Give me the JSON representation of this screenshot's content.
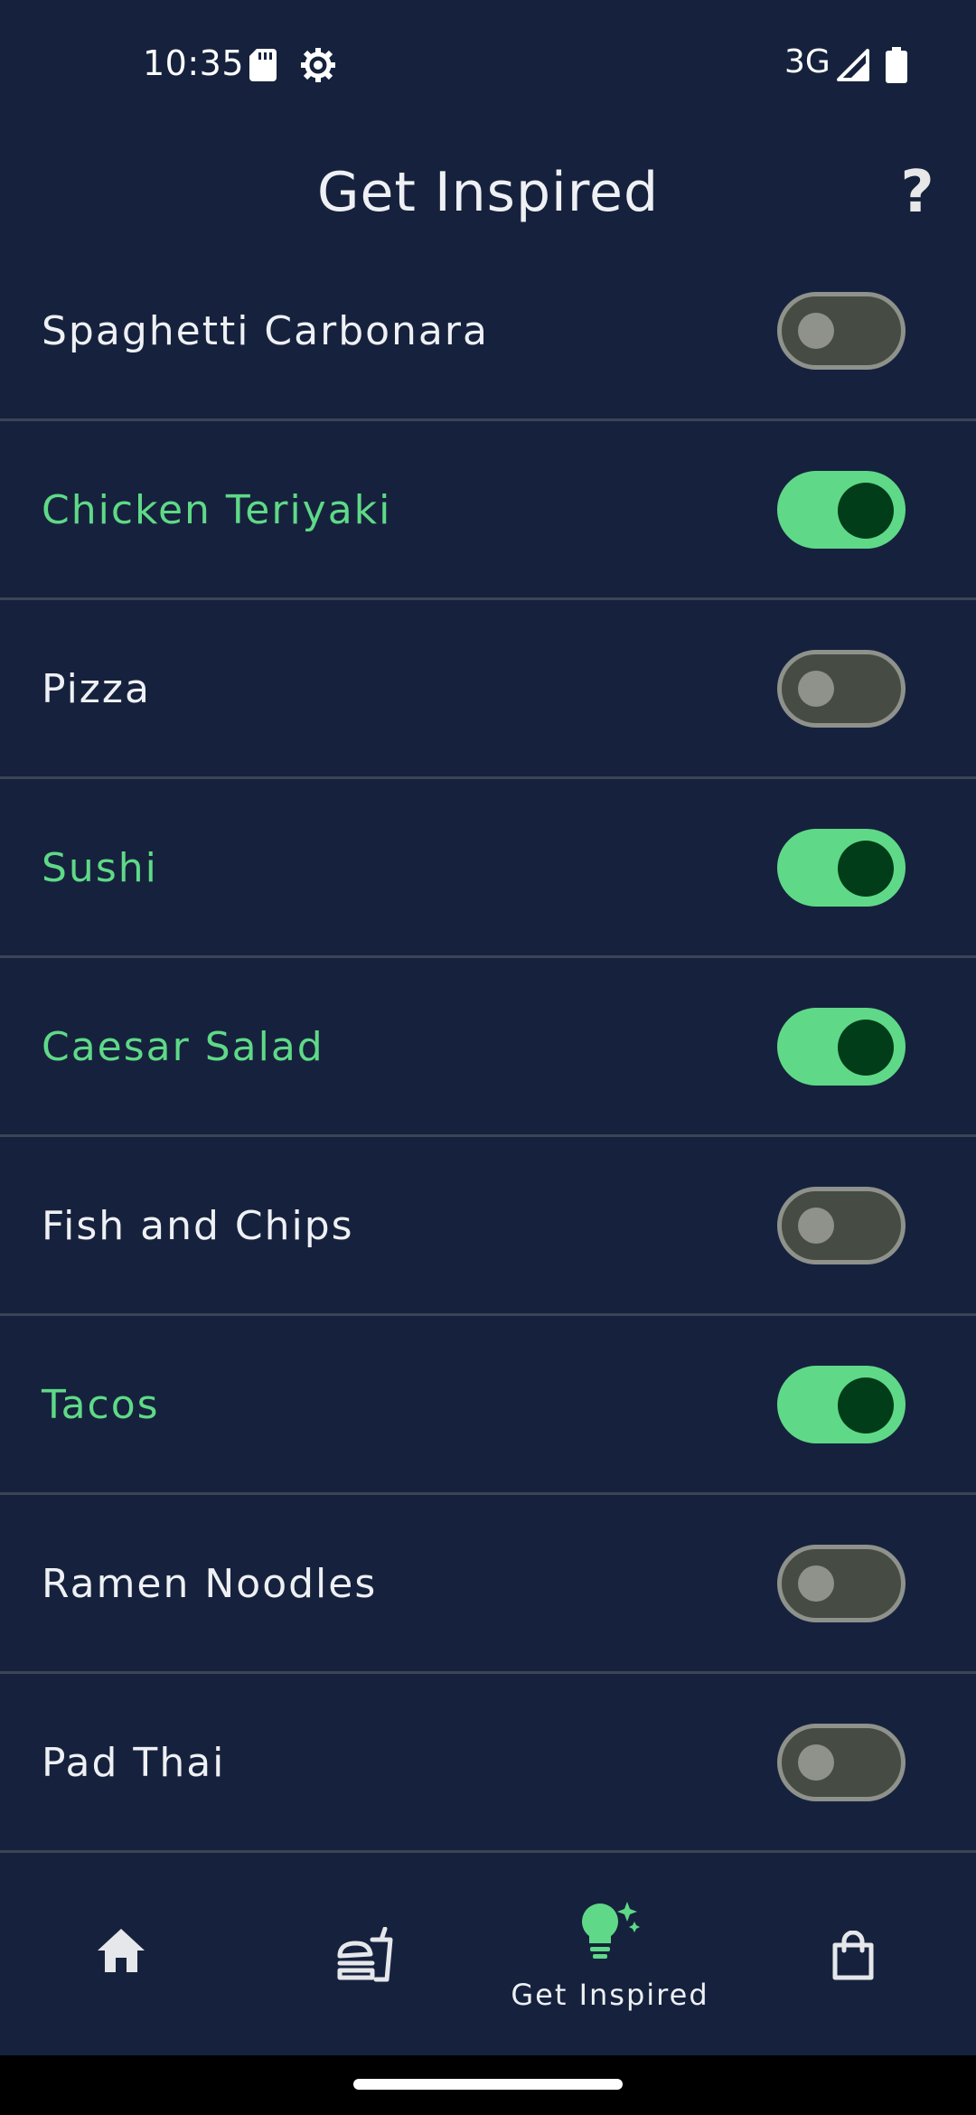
{
  "status_bar": {
    "time": "10:35",
    "network": "3G",
    "icons": [
      "sd-card-icon",
      "gear-icon",
      "signal-icon",
      "battery-icon"
    ]
  },
  "header": {
    "title": "Get Inspired",
    "help_label": "?"
  },
  "colors": {
    "background": "#16223d",
    "accent": "#5fd987",
    "toggle_off_track": "#464b44",
    "toggle_off_knob": "#8e928b",
    "toggle_on_knob": "#023d1a",
    "divider": "#3b4555"
  },
  "dishes": [
    {
      "label": "Spaghetti Carbonara",
      "enabled": false
    },
    {
      "label": "Chicken Teriyaki",
      "enabled": true
    },
    {
      "label": "Pizza",
      "enabled": false
    },
    {
      "label": "Sushi",
      "enabled": true
    },
    {
      "label": "Caesar Salad",
      "enabled": true
    },
    {
      "label": "Fish and Chips",
      "enabled": false
    },
    {
      "label": "Tacos",
      "enabled": true
    },
    {
      "label": "Ramen Noodles",
      "enabled": false
    },
    {
      "label": "Pad Thai",
      "enabled": false
    }
  ],
  "bottom_nav": {
    "items": [
      {
        "icon": "home-icon",
        "label": ""
      },
      {
        "icon": "food-icon",
        "label": ""
      },
      {
        "icon": "lightbulb-icon",
        "label": "Get Inspired",
        "active": true
      },
      {
        "icon": "shopping-bag-icon",
        "label": ""
      }
    ]
  }
}
